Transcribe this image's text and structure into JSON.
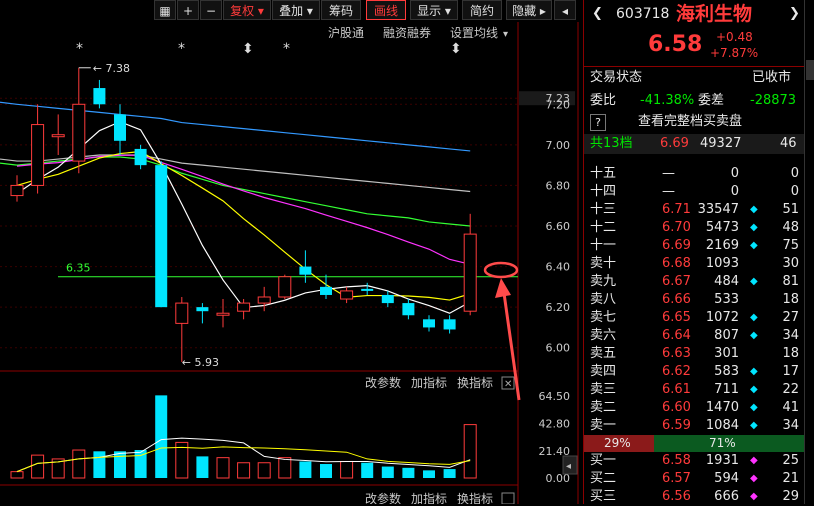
{
  "toolbar": {
    "buttons": [
      "+",
      "−",
      "复权",
      "叠加",
      "筹码",
      "画线",
      "显示",
      "简约",
      "隐藏"
    ],
    "active_index": 5
  },
  "chart": {
    "sub_tabs": [
      "沪股通",
      "融资融券",
      "设置均线"
    ],
    "price_axis": [
      "7.23",
      "7.20",
      "7.00",
      "6.80",
      "6.60",
      "6.40",
      "6.20",
      "6.00"
    ],
    "high_label": "7.38",
    "low_label": "5.93",
    "line_label": "6.35",
    "vol_axis": [
      "64.50",
      "42.80",
      "21.40",
      "0.00"
    ],
    "indicator_links": [
      "改参数",
      "加指标",
      "换指标"
    ],
    "markers": [
      "*",
      "*",
      "*",
      "*",
      "*"
    ]
  },
  "chart_data": {
    "type": "candlestick",
    "price_ylim": [
      6.0,
      7.23
    ],
    "candles": [
      {
        "o": 6.75,
        "c": 6.8,
        "h": 6.85,
        "l": 6.72
      },
      {
        "o": 6.8,
        "c": 7.1,
        "h": 7.2,
        "l": 6.76
      },
      {
        "o": 7.05,
        "c": 7.05,
        "h": 7.15,
        "l": 6.95
      },
      {
        "o": 6.92,
        "c": 7.2,
        "h": 7.38,
        "l": 6.86
      },
      {
        "o": 7.28,
        "c": 7.2,
        "h": 7.32,
        "l": 7.18
      },
      {
        "o": 7.15,
        "c": 7.02,
        "h": 7.2,
        "l": 6.95
      },
      {
        "o": 6.98,
        "c": 6.9,
        "h": 7.0,
        "l": 6.88
      },
      {
        "o": 6.9,
        "c": 6.2,
        "h": 6.92,
        "l": 6.2
      },
      {
        "o": 6.12,
        "c": 6.22,
        "h": 6.25,
        "l": 5.93
      },
      {
        "o": 6.2,
        "c": 6.18,
        "h": 6.22,
        "l": 6.12
      },
      {
        "o": 6.17,
        "c": 6.17,
        "h": 6.24,
        "l": 6.1
      },
      {
        "o": 6.18,
        "c": 6.22,
        "h": 6.24,
        "l": 6.14
      },
      {
        "o": 6.22,
        "c": 6.25,
        "h": 6.3,
        "l": 6.18
      },
      {
        "o": 6.25,
        "c": 6.35,
        "h": 6.36,
        "l": 6.24
      },
      {
        "o": 6.4,
        "c": 6.36,
        "h": 6.48,
        "l": 6.32
      },
      {
        "o": 6.3,
        "c": 6.26,
        "h": 6.36,
        "l": 6.24
      },
      {
        "o": 6.24,
        "c": 6.28,
        "h": 6.3,
        "l": 6.22
      },
      {
        "o": 6.29,
        "c": 6.28,
        "h": 6.32,
        "l": 6.26
      },
      {
        "o": 6.26,
        "c": 6.22,
        "h": 6.28,
        "l": 6.2
      },
      {
        "o": 6.22,
        "c": 6.16,
        "h": 6.24,
        "l": 6.14
      },
      {
        "o": 6.14,
        "c": 6.1,
        "h": 6.16,
        "l": 6.08
      },
      {
        "o": 6.14,
        "c": 6.09,
        "h": 6.16,
        "l": 6.07
      },
      {
        "o": 6.18,
        "c": 6.56,
        "h": 6.66,
        "l": 6.16
      }
    ],
    "volumes": [
      5,
      18,
      15,
      22,
      21,
      21,
      22,
      65,
      28,
      17,
      16,
      12,
      12,
      16,
      13,
      11,
      13,
      12,
      9,
      8,
      6,
      7,
      42
    ],
    "vol_ylim": [
      0,
      64.5
    ]
  },
  "quote": {
    "code": "603718",
    "name": "海利生物",
    "price": "6.58",
    "change": "+0.48",
    "pct": "+7.87%",
    "status_label": "交易状态",
    "status_value": "已收市",
    "wb_label": "委比",
    "wb_value": "-41.38%",
    "wc_label": "委差",
    "wc_value": "-28873",
    "full_book": "查看完整档买卖盘",
    "help": "?",
    "total_label": "共13档",
    "total_price": "6.69",
    "total_vol": "49327",
    "total_count": "46"
  },
  "asks": [
    {
      "label": "十五",
      "price": "—",
      "vol": "0",
      "cnt": "0",
      "dot": ""
    },
    {
      "label": "十四",
      "price": "—",
      "vol": "0",
      "cnt": "0",
      "dot": ""
    },
    {
      "label": "十三",
      "price": "6.71",
      "vol": "33547",
      "cnt": "51",
      "dot": "cyan"
    },
    {
      "label": "十二",
      "price": "6.70",
      "vol": "5473",
      "cnt": "48",
      "dot": "cyan"
    },
    {
      "label": "十一",
      "price": "6.69",
      "vol": "2169",
      "cnt": "75",
      "dot": "cyan"
    },
    {
      "label": "卖十",
      "price": "6.68",
      "vol": "1093",
      "cnt": "30",
      "dot": ""
    },
    {
      "label": "卖九",
      "price": "6.67",
      "vol": "484",
      "cnt": "81",
      "dot": "cyan"
    },
    {
      "label": "卖八",
      "price": "6.66",
      "vol": "533",
      "cnt": "18",
      "dot": ""
    },
    {
      "label": "卖七",
      "price": "6.65",
      "vol": "1072",
      "cnt": "27",
      "dot": "cyan"
    },
    {
      "label": "卖六",
      "price": "6.64",
      "vol": "807",
      "cnt": "34",
      "dot": "cyan"
    },
    {
      "label": "卖五",
      "price": "6.63",
      "vol": "301",
      "cnt": "18",
      "dot": ""
    },
    {
      "label": "卖四",
      "price": "6.62",
      "vol": "583",
      "cnt": "17",
      "dot": "cyan"
    },
    {
      "label": "卖三",
      "price": "6.61",
      "vol": "711",
      "cnt": "22",
      "dot": "cyan"
    },
    {
      "label": "卖二",
      "price": "6.60",
      "vol": "1470",
      "cnt": "41",
      "dot": "cyan"
    },
    {
      "label": "卖一",
      "price": "6.59",
      "vol": "1084",
      "cnt": "34",
      "dot": "cyan"
    }
  ],
  "ratio": {
    "buy": "29%",
    "sell": "71%",
    "buy_frac": 0.29
  },
  "bids": [
    {
      "label": "买一",
      "price": "6.58",
      "vol": "1931",
      "cnt": "25",
      "dot": "mag"
    },
    {
      "label": "买二",
      "price": "6.57",
      "vol": "594",
      "cnt": "21",
      "dot": "mag"
    },
    {
      "label": "买三",
      "price": "6.56",
      "vol": "666",
      "cnt": "29",
      "dot": "mag"
    }
  ],
  "colors": {
    "up": "#ff3b3b",
    "down": "#00e5ff",
    "ma5": "#ffffff",
    "ma10": "#ffff00",
    "ma20": "#ff33ff",
    "ma30": "#33ff33",
    "ma60": "#c0c0c0",
    "ma120": "#3399ff",
    "hline": "#33ff33",
    "arrow": "#ff4b4b"
  }
}
